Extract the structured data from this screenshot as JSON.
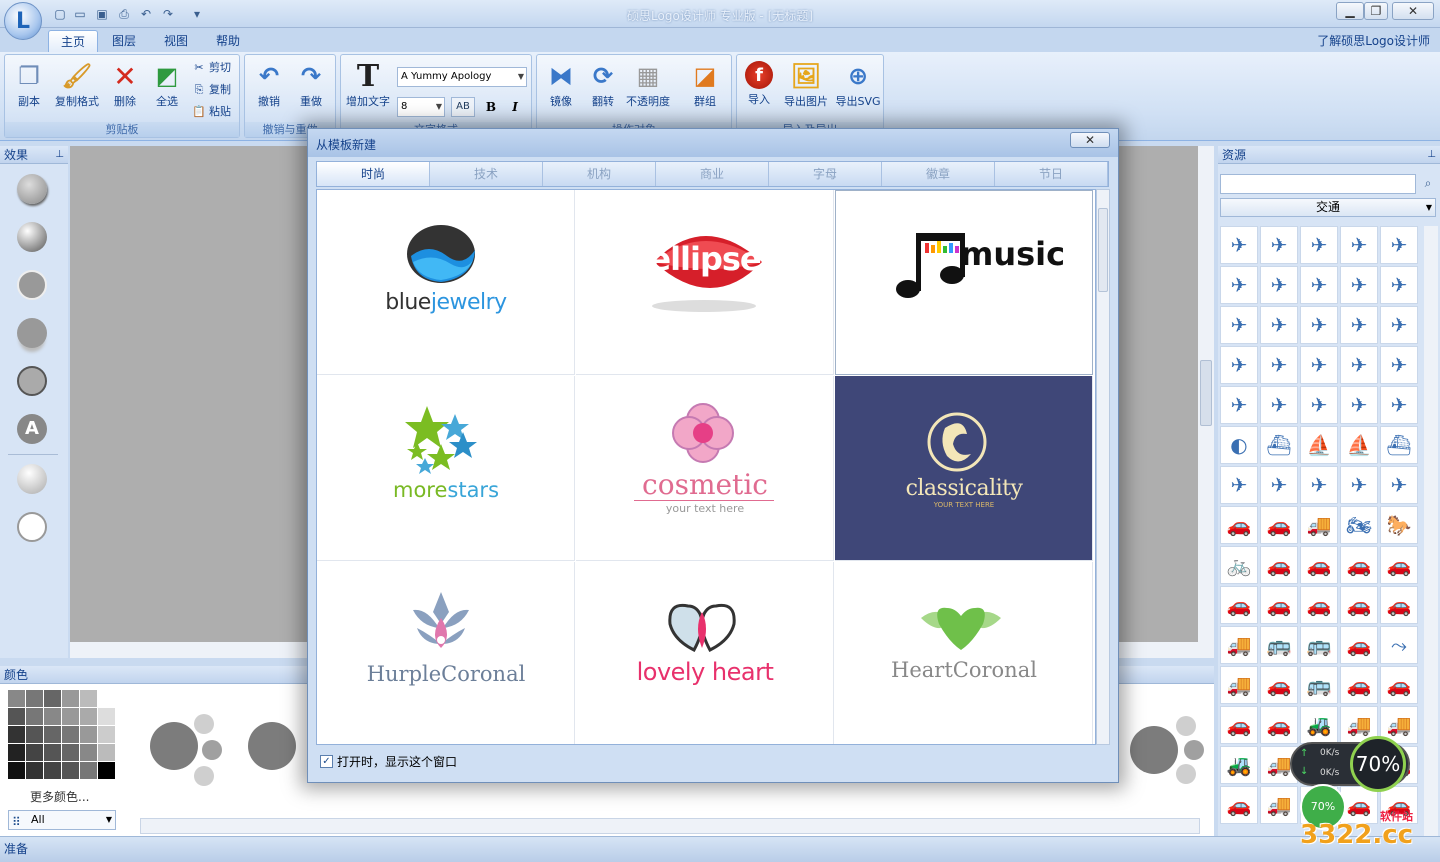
{
  "window": {
    "title": "硕思Logo设计师 专业版 - [无标题]",
    "help_link": "了解硕思Logo设计师"
  },
  "tabs": [
    {
      "label": "主页"
    },
    {
      "label": "图层"
    },
    {
      "label": "视图"
    },
    {
      "label": "帮助"
    }
  ],
  "ribbon": {
    "clipboard": {
      "label": "剪贴板",
      "copy_obj": "副本",
      "format_painter": "复制格式",
      "delete": "删除",
      "select_all": "全选",
      "cut": "剪切",
      "copy": "复制",
      "paste": "粘贴"
    },
    "undo": {
      "label": "撤销与重做",
      "undo": "撤销",
      "redo": "重做"
    },
    "text": {
      "label": "文字格式",
      "add_text": "增加文字",
      "font": "A Yummy Apology",
      "size": "8",
      "bold": "B",
      "italic": "I"
    },
    "operate": {
      "label": "操作对象",
      "mirror": "镜像",
      "flip": "翻转",
      "opacity": "不透明度",
      "group": "群组"
    },
    "import_export": {
      "label": "导入及导出",
      "import": "导入",
      "export_image": "导出图片",
      "export_svg": "导出SVG"
    }
  },
  "left_pane": {
    "title": "效果"
  },
  "right_pane": {
    "title": "资源",
    "search_value": "",
    "category": "交通"
  },
  "bottom_pane": {
    "title": "颜色",
    "more_colors": "更多颜色...",
    "filter": "All"
  },
  "status": {
    "text": "准备"
  },
  "dialog": {
    "title": "从模板新建",
    "categories": [
      "时尚",
      "技术",
      "机构",
      "商业",
      "字母",
      "徽章",
      "节日"
    ],
    "templates": [
      {
        "name": "bluejewelry",
        "part1": "blue",
        "part2": "jewelry"
      },
      {
        "name": "ellipse"
      },
      {
        "name": "music"
      },
      {
        "name": "morestars",
        "part1": "more",
        "part2": "stars"
      },
      {
        "name": "cosmetic",
        "tagline": "your text here"
      },
      {
        "name": "classicality",
        "tagline": "YOUR TEXT HERE"
      },
      {
        "name": "HurpleCoronal"
      },
      {
        "name": "lovely heart"
      },
      {
        "name": "HeartCoronal"
      }
    ],
    "show_on_open": "打开时，显示这个窗口"
  },
  "overlay": {
    "cpu": "70%",
    "net_up": "0K/s",
    "net_down": "0K/s",
    "badge": "70%",
    "watermark": "3322.cc",
    "watermark_label": "软件站"
  },
  "colors": {
    "accent": "#15428b",
    "selected_tile": "#3f4778"
  }
}
